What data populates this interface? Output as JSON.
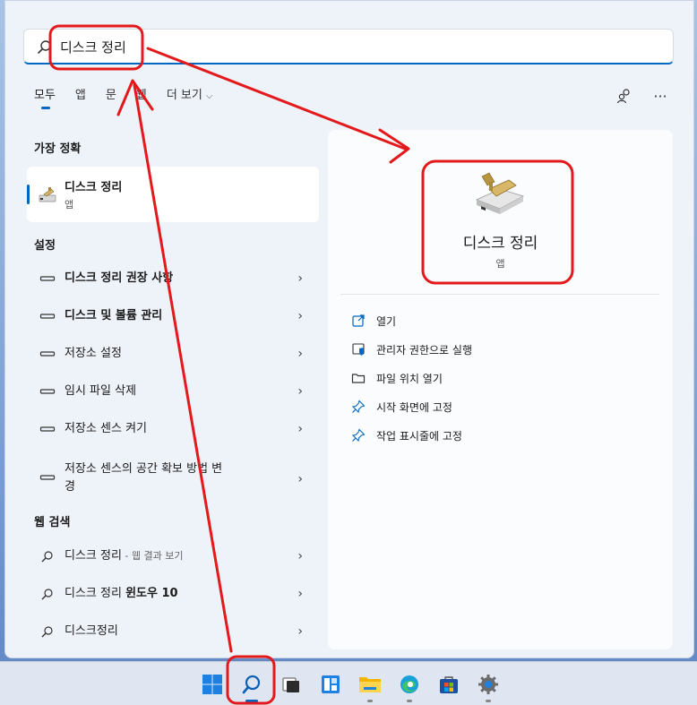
{
  "search": {
    "value": "디스크 정리",
    "icon": "search-icon"
  },
  "tabs": [
    {
      "label": "모두",
      "active": true
    },
    {
      "label": "앱",
      "active": false
    },
    {
      "label": "문",
      "active": false
    },
    {
      "label": "웹",
      "active": false
    },
    {
      "label": "더 보기",
      "active": false
    }
  ],
  "top_right": {
    "account_icon": "account-switch-icon",
    "more_label": "···"
  },
  "best_match": {
    "section": "가장 정확",
    "title": "디스크 정리",
    "subtitle": "앱"
  },
  "settings": {
    "section": "설정",
    "items": [
      {
        "label": "디스크 정리 권장 사항",
        "bold": true
      },
      {
        "label": "디스크 및 볼륨 관리",
        "bold": true
      },
      {
        "label": "저장소 설정",
        "bold": false
      },
      {
        "label": "임시 파일 삭제",
        "bold": false
      },
      {
        "label": "저장소 센스 켜기",
        "bold": false
      },
      {
        "label": "저장소 센스의 공간 확보 방법 변경",
        "line1": "저장소 센스의 공간 확보 방법 변",
        "line2": "경",
        "bold": false
      }
    ]
  },
  "web": {
    "section": "웹 검색",
    "items": [
      {
        "label": "디스크 정리",
        "suffix": " - 웹 결과 보기"
      },
      {
        "label": "디스크 정리 ",
        "bold_part": "윈도우 10"
      },
      {
        "label": "디스크정리"
      }
    ]
  },
  "detail": {
    "title": "디스크 정리",
    "subtitle": "앱",
    "actions": [
      {
        "label": "열기",
        "icon": "open-icon"
      },
      {
        "label": "관리자 권한으로 실행",
        "icon": "shield-icon"
      },
      {
        "label": "파일 위치 열기",
        "icon": "folder-icon"
      },
      {
        "label": "시작 화면에 고정",
        "icon": "pin-icon"
      },
      {
        "label": "작업 표시줄에 고정",
        "icon": "pin-icon"
      }
    ]
  },
  "taskbar": {
    "items": [
      "start-icon",
      "search-icon",
      "task-view-icon",
      "widgets-icon",
      "file-explorer-icon",
      "edge-icon",
      "store-icon",
      "settings-icon"
    ]
  },
  "colors": {
    "accent": "#0067c0",
    "annotation": "#e3191c"
  }
}
